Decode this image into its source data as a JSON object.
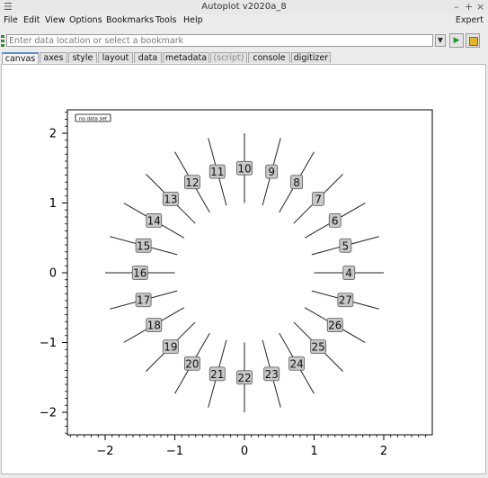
{
  "window": {
    "title": "Autoplot v2020a_8",
    "controls": [
      "–",
      "+",
      "×"
    ]
  },
  "menu": {
    "items": [
      "File",
      "Edit",
      "View",
      "Options",
      "Bookmarks",
      "Tools",
      "Help"
    ],
    "expert": "Expert"
  },
  "address": {
    "placeholder": "Enter data location or select a bookmark"
  },
  "tabs": [
    "canvas",
    "axes",
    "style",
    "layout",
    "data",
    "metadata",
    "(script)",
    "console",
    "digitizer"
  ],
  "plot": {
    "no_data_label": "no data set",
    "x_ticks": [
      "−2",
      "−1",
      "0",
      "1",
      "2"
    ],
    "y_ticks": [
      "2",
      "1",
      "0",
      "−1",
      "−2"
    ]
  },
  "chart_data": {
    "type": "scatter",
    "description_labels": [
      "4",
      "5",
      "6",
      "7",
      "8",
      "9",
      "10",
      "11",
      "12",
      "13",
      "14",
      "15",
      "16",
      "17",
      "18",
      "19",
      "20",
      "21",
      "22",
      "23",
      "24",
      "25",
      "26",
      "27"
    ],
    "points": [
      {
        "label": "4",
        "x": 1.5,
        "y": 0.0
      },
      {
        "label": "5",
        "x": 1.45,
        "y": 0.39
      },
      {
        "label": "6",
        "x": 1.3,
        "y": 0.75
      },
      {
        "label": "7",
        "x": 1.06,
        "y": 1.06
      },
      {
        "label": "8",
        "x": 0.75,
        "y": 1.3
      },
      {
        "label": "9",
        "x": 0.39,
        "y": 1.45
      },
      {
        "label": "10",
        "x": 0.0,
        "y": 1.5
      },
      {
        "label": "11",
        "x": -0.39,
        "y": 1.45
      },
      {
        "label": "12",
        "x": -0.75,
        "y": 1.3
      },
      {
        "label": "13",
        "x": -1.06,
        "y": 1.06
      },
      {
        "label": "14",
        "x": -1.3,
        "y": 0.75
      },
      {
        "label": "15",
        "x": -1.45,
        "y": 0.39
      },
      {
        "label": "16",
        "x": -1.5,
        "y": 0.0
      },
      {
        "label": "17",
        "x": -1.45,
        "y": -0.39
      },
      {
        "label": "18",
        "x": -1.3,
        "y": -0.75
      },
      {
        "label": "19",
        "x": -1.06,
        "y": -1.06
      },
      {
        "label": "20",
        "x": -0.75,
        "y": -1.3
      },
      {
        "label": "21",
        "x": -0.39,
        "y": -1.45
      },
      {
        "label": "22",
        "x": 0.0,
        "y": -1.5
      },
      {
        "label": "23",
        "x": 0.39,
        "y": -1.45
      },
      {
        "label": "24",
        "x": 0.75,
        "y": -1.3
      },
      {
        "label": "25",
        "x": 1.06,
        "y": -1.06
      },
      {
        "label": "26",
        "x": 1.3,
        "y": -0.75
      },
      {
        "label": "27",
        "x": 1.45,
        "y": -0.39
      }
    ],
    "radial_lines": {
      "inner_radius": 1.0,
      "outer_radius": 2.0
    },
    "xlim": [
      -2.5,
      2.7
    ],
    "ylim": [
      -2.3,
      2.35
    ],
    "xlabel": "",
    "ylabel": "",
    "grid": false
  }
}
